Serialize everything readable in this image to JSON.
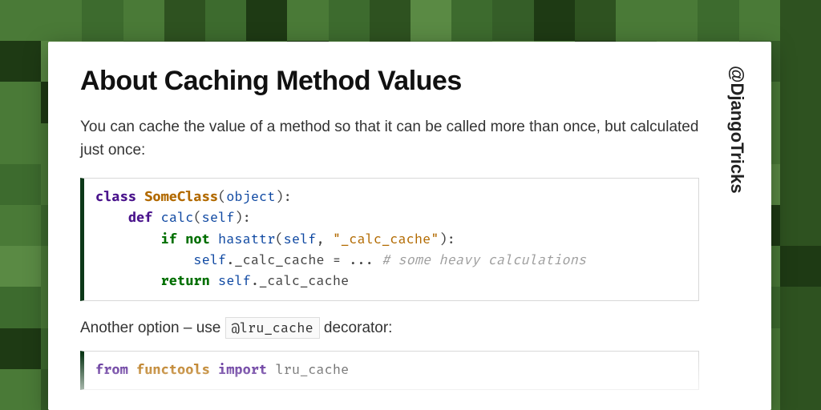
{
  "handle": "@DjangoTricks",
  "title": "About Caching Method Values",
  "intro": "You can cache the value of a method so that it can be called more than once, but calculated just once:",
  "code1": {
    "l1_kw": "class",
    "l1_cls": "SomeClass",
    "l1_p1": "(",
    "l1_obj": "object",
    "l1_p2": "):",
    "l2_kw": "def",
    "l2_name": "calc",
    "l2_p1": "(",
    "l2_self": "self",
    "l2_p2": "):",
    "l3_kw": "if not",
    "l3_fn": "hasattr",
    "l3_p1": "(",
    "l3_self": "self",
    "l3_p2": ", ",
    "l3_str": "\"_calc_cache\"",
    "l3_p3": "):",
    "l4_self": "self",
    "l4_attr": "._calc_cache = ... ",
    "l4_cmt": "# some heavy calculations",
    "l5_kw": "return",
    "l5_self": "self",
    "l5_attr": "._calc_cache"
  },
  "outro_before": "Another option – use ",
  "outro_code": "@lru_cache",
  "outro_after": " decorator:",
  "code2": {
    "l1_from": "from",
    "l1_mod": "functools",
    "l1_import": "import",
    "l1_name": "lru_cache"
  }
}
